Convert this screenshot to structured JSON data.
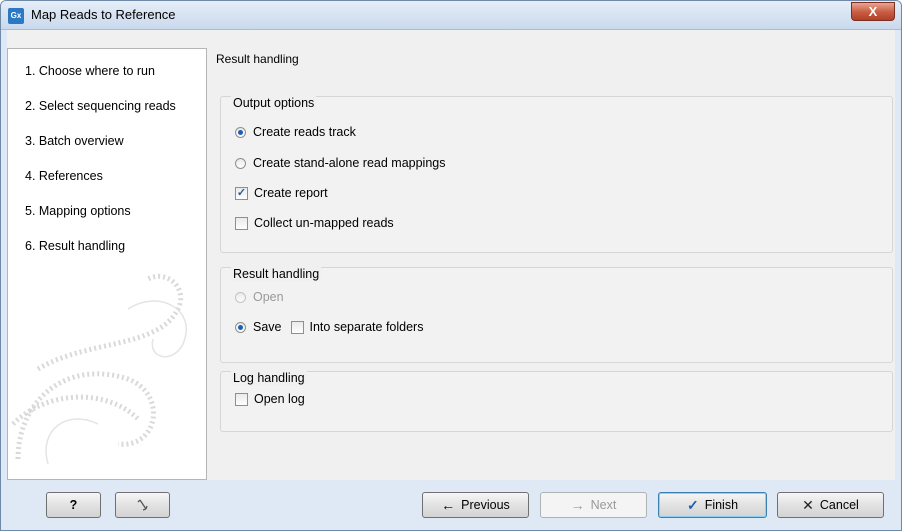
{
  "window": {
    "title": "Map Reads to Reference",
    "app_icon_text": "Gx",
    "close_label": "X"
  },
  "sidebar": {
    "steps": [
      "1.  Choose where to run",
      "2.  Select sequencing reads",
      "3.  Batch overview",
      "4.  References",
      "5.  Mapping options",
      "6.  Result handling"
    ]
  },
  "main": {
    "heading": "Result handling",
    "output_options": {
      "label": "Output options",
      "create_reads_track": "Create reads track",
      "create_standalone": "Create stand-alone read mappings",
      "create_report": "Create report",
      "collect_unmapped": "Collect un-mapped reads"
    },
    "result_handling": {
      "label": "Result handling",
      "open": "Open",
      "save": "Save",
      "into_separate_folders": "Into separate folders"
    },
    "log_handling": {
      "label": "Log handling",
      "open_log": "Open log"
    }
  },
  "buttons": {
    "help": "?",
    "previous": "Previous",
    "next": "Next",
    "finish": "Finish",
    "cancel": "Cancel"
  }
}
